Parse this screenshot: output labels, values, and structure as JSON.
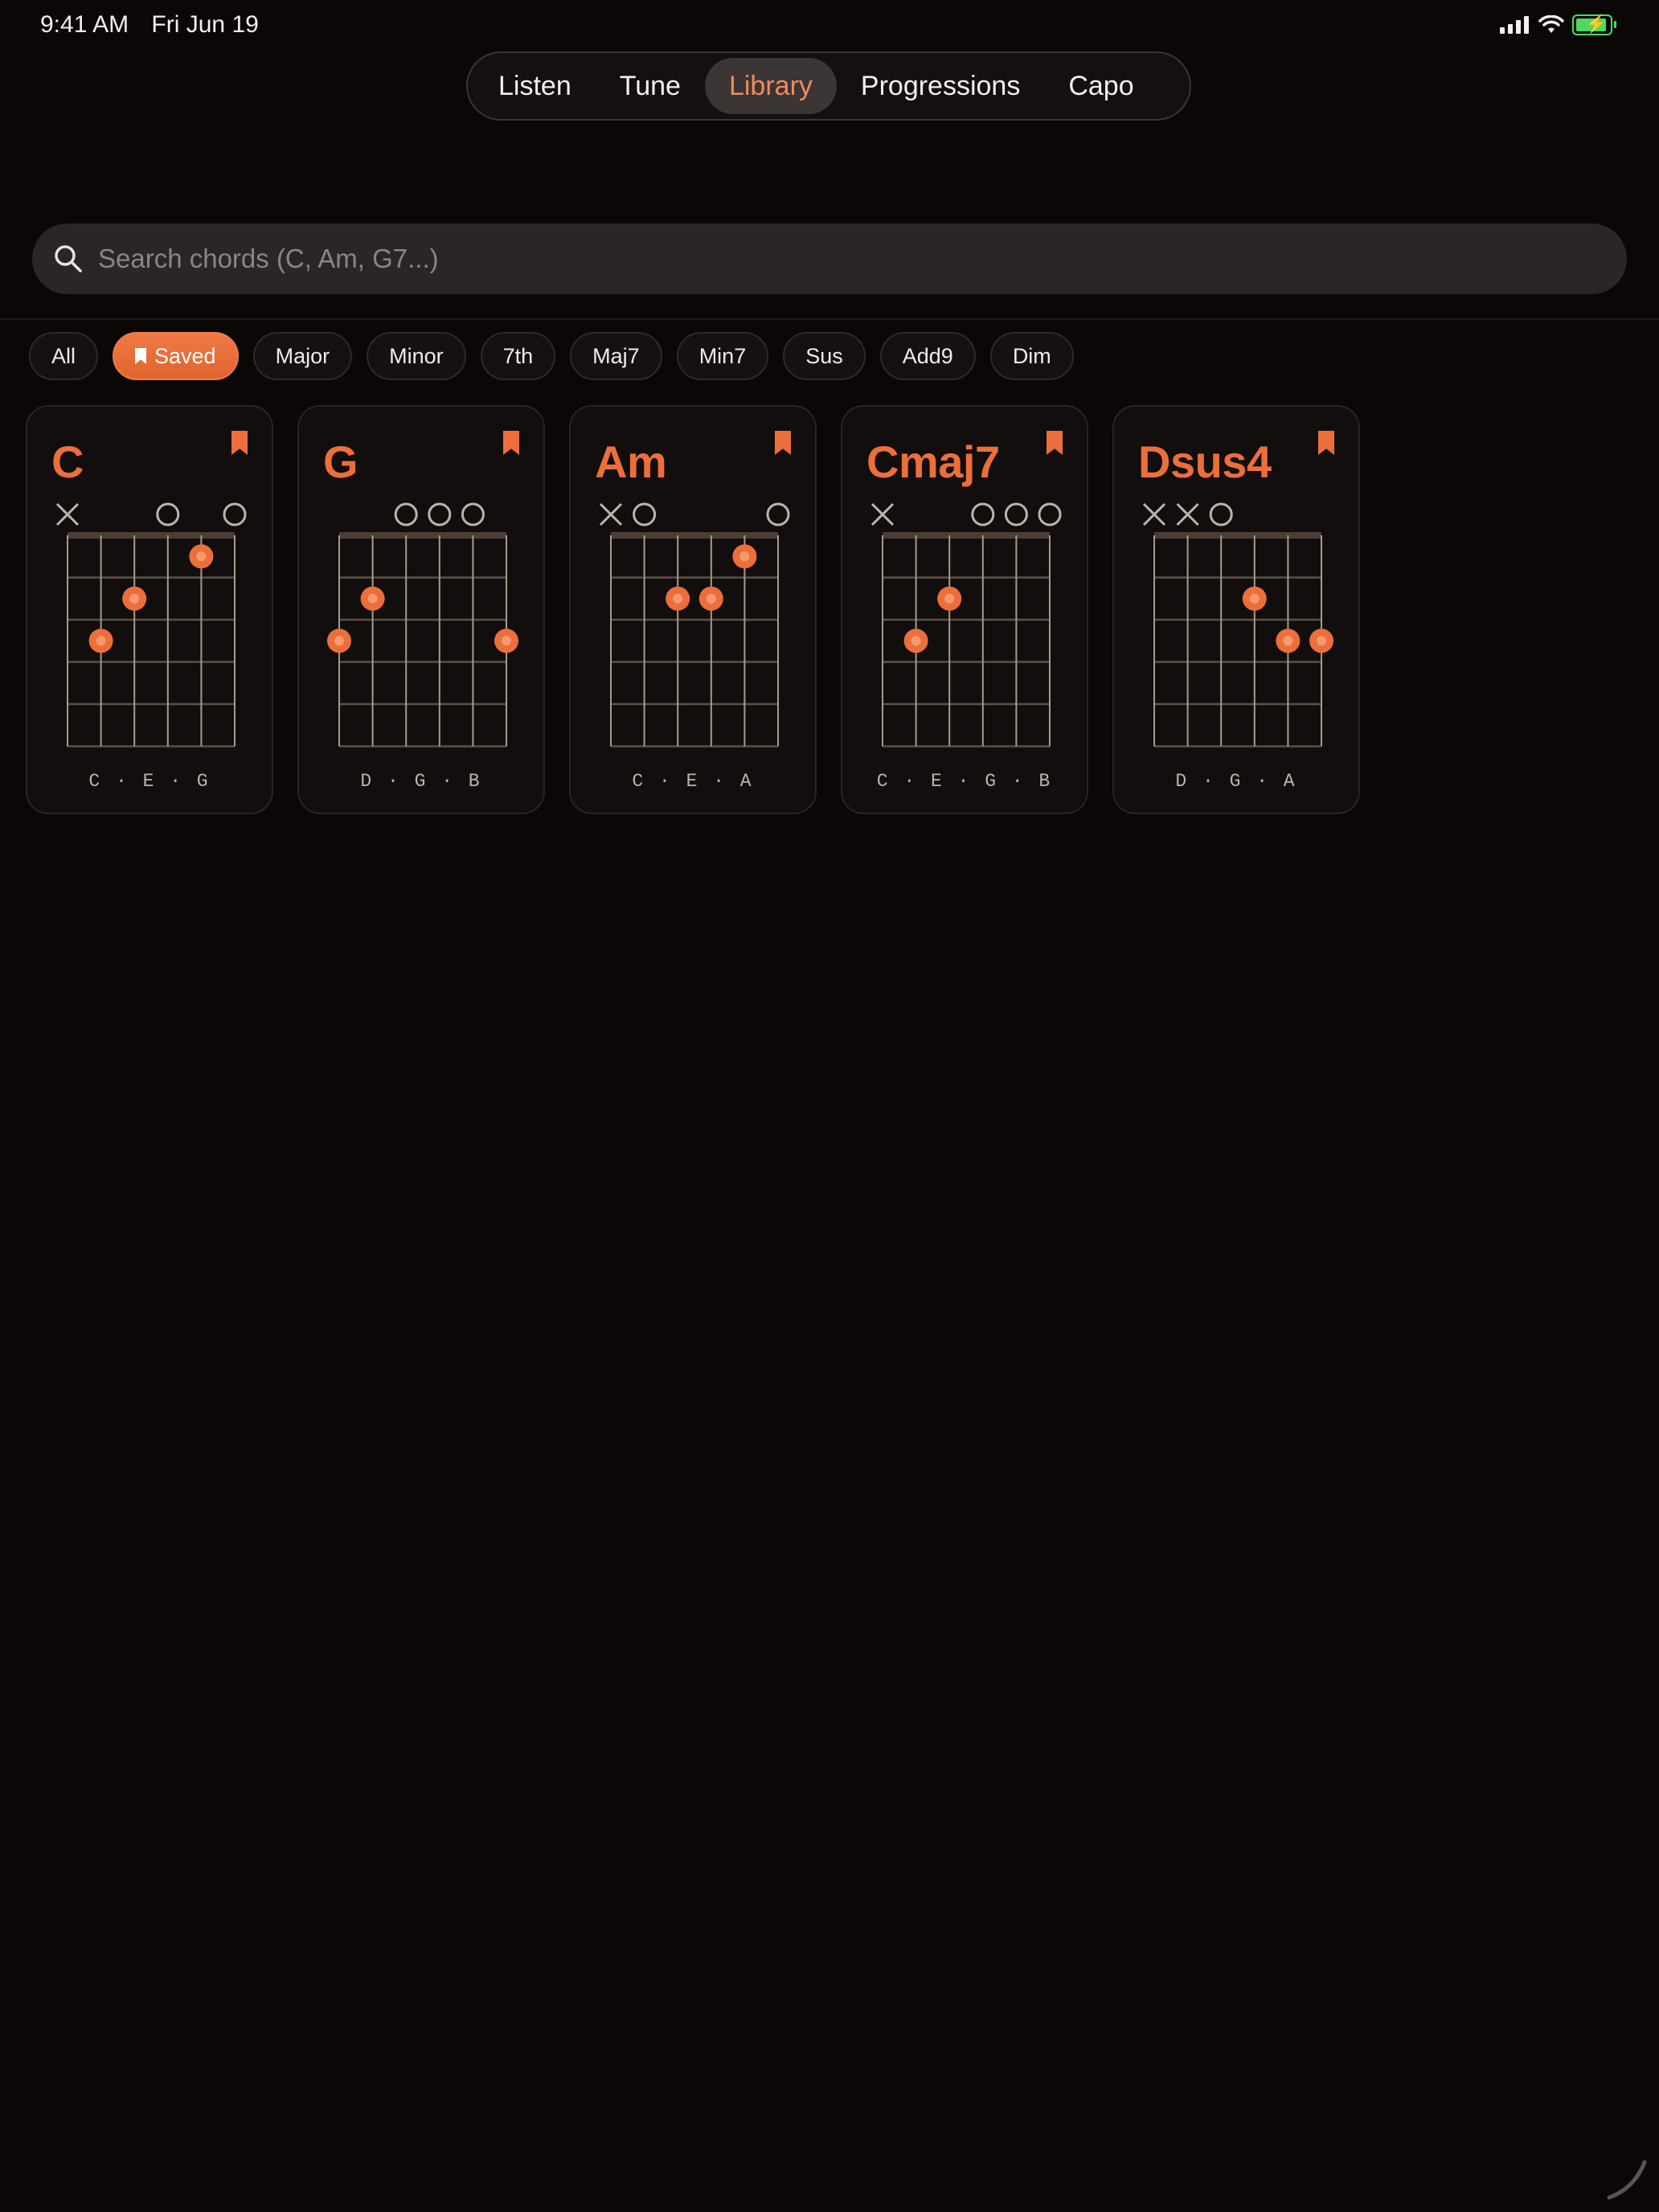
{
  "status_bar": {
    "time": "9:41 AM",
    "date": "Fri Jun 19"
  },
  "nav": {
    "tabs": [
      {
        "label": "Listen",
        "active": false
      },
      {
        "label": "Tune",
        "active": false
      },
      {
        "label": "Library",
        "active": true
      },
      {
        "label": "Progressions",
        "active": false
      },
      {
        "label": "Capo",
        "active": false
      }
    ]
  },
  "search": {
    "placeholder": "Search chords (C, Am, G7...)",
    "value": "",
    "icon": "search-icon"
  },
  "filters": [
    {
      "label": "All",
      "active": false
    },
    {
      "label": "Saved",
      "active": true,
      "icon": "bookmark-icon"
    },
    {
      "label": "Major",
      "active": false
    },
    {
      "label": "Minor",
      "active": false
    },
    {
      "label": "7th",
      "active": false
    },
    {
      "label": "Maj7",
      "active": false
    },
    {
      "label": "Min7",
      "active": false
    },
    {
      "label": "Sus",
      "active": false
    },
    {
      "label": "Add9",
      "active": false
    },
    {
      "label": "Dim",
      "active": false
    }
  ],
  "chords": [
    {
      "name": "C",
      "notes": "C · E · G",
      "saved": true,
      "strings": [
        "x",
        3,
        2,
        0,
        1,
        0
      ]
    },
    {
      "name": "G",
      "notes": "D · G · B",
      "saved": true,
      "strings": [
        3,
        2,
        0,
        0,
        0,
        3
      ]
    },
    {
      "name": "Am",
      "notes": "C · E · A",
      "saved": true,
      "strings": [
        "x",
        0,
        2,
        2,
        1,
        0
      ]
    },
    {
      "name": "Cmaj7",
      "notes": "C · E · G · B",
      "saved": true,
      "strings": [
        "x",
        3,
        2,
        0,
        0,
        0
      ]
    },
    {
      "name": "Dsus4",
      "notes": "D · G · A",
      "saved": true,
      "strings": [
        "x",
        "x",
        0,
        2,
        3,
        3
      ]
    }
  ],
  "colors": {
    "accent": "#ec6f3a",
    "background": "#0b0707",
    "card": "#130e0e",
    "fret": "#a89a8c"
  }
}
